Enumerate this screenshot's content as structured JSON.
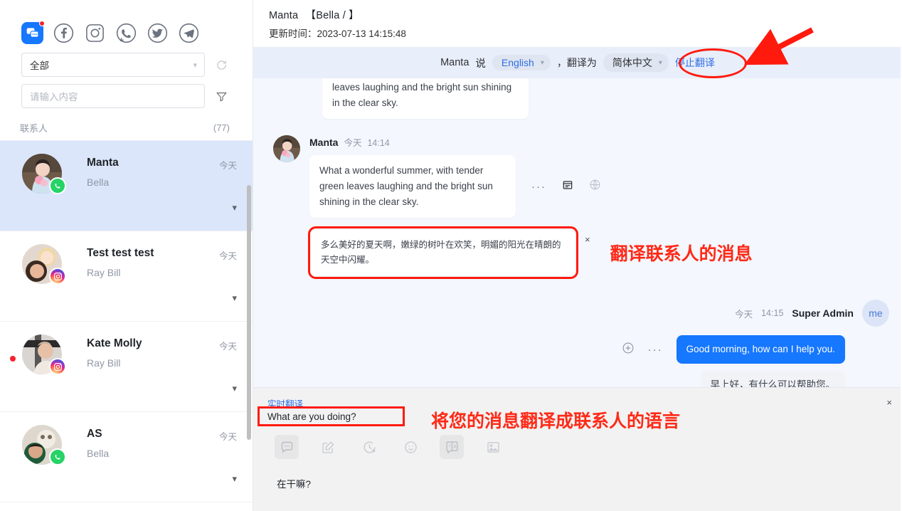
{
  "sidebar": {
    "channels": [
      {
        "name": "app-logo-icon",
        "label": "App",
        "active": true,
        "badge": true
      },
      {
        "name": "facebook-icon",
        "label": "Facebook",
        "active": false,
        "badge": false
      },
      {
        "name": "instagram-icon",
        "label": "Instagram",
        "active": false,
        "badge": false
      },
      {
        "name": "whatsapp-icon",
        "label": "WhatsApp",
        "active": false,
        "badge": false
      },
      {
        "name": "twitter-icon",
        "label": "Twitter",
        "active": false,
        "badge": false
      },
      {
        "name": "telegram-icon",
        "label": "Telegram",
        "active": false,
        "badge": false
      }
    ],
    "filter_select": {
      "value": "全部"
    },
    "refresh_icon": "refresh-icon",
    "search_input": {
      "value": "",
      "placeholder": "请输入内容"
    },
    "filter_icon": "funnel-filter-icon",
    "contacts_header": {
      "label": "联系人",
      "count": "(77)"
    },
    "contacts": [
      {
        "name": "Manta",
        "sub": "Bella",
        "time": "今天",
        "platform": "whatsapp",
        "active": true,
        "unread": false
      },
      {
        "name": "Test test test",
        "sub": "Ray Bill",
        "time": "今天",
        "platform": "instagram",
        "active": false,
        "unread": false
      },
      {
        "name": "Kate Molly",
        "sub": "Ray Bill",
        "time": "今天",
        "platform": "instagram",
        "active": false,
        "unread": true
      },
      {
        "name": "AS",
        "sub": "Bella",
        "time": "今天",
        "platform": "whatsapp",
        "active": false,
        "unread": false
      }
    ]
  },
  "chat": {
    "header": {
      "title": "Manta",
      "nickname": "【Bella / 】",
      "updated": "更新时间：2023-07-13 14:15:48"
    },
    "translate_bar": {
      "who": "Manta",
      "says": "说",
      "source_lang": "English",
      "middle": "，翻译为",
      "target_lang": "简体中文",
      "stop_label": "停止翻译"
    },
    "messages": [
      {
        "id": "partial-incoming",
        "direction": "in",
        "text": "leaves laughing and the bright sun shining in the clear sky."
      },
      {
        "id": "manta-message",
        "direction": "in",
        "sender": "Manta",
        "day": "今天",
        "time": "14:14",
        "text": "What a wonderful summer, with tender green leaves laughing and the bright sun shining in the clear sky.",
        "actions": [
          "more-icon",
          "note-icon",
          "globe-translate-icon"
        ],
        "translation": "多么美好的夏天啊，嫩绿的树叶在欢笑，明媚的阳光在晴朗的天空中闪耀。",
        "translation_close": "×"
      },
      {
        "id": "admin-message",
        "direction": "out",
        "sender": "Super Admin",
        "day": "今天",
        "time": "14:15",
        "avatar_label": "me",
        "text": "Good morning, how can I help you.",
        "translation": "早上好，有什么可以帮助您。",
        "actions": [
          "add-circle-icon",
          "more-icon"
        ]
      }
    ]
  },
  "composer": {
    "realtime_label": "实时翻译",
    "realtime_text": "What are you doing?",
    "close_label": "×",
    "tools": [
      {
        "name": "quick-reply-icon",
        "active": true
      },
      {
        "name": "compose-edit-icon",
        "active": false
      },
      {
        "name": "history-schedule-icon",
        "active": false
      },
      {
        "name": "emoji-icon",
        "active": false
      },
      {
        "name": "translate-icon",
        "active": true
      },
      {
        "name": "image-icon",
        "active": false
      }
    ],
    "input_value": "在干嘛?"
  },
  "annotations": {
    "stop_translate_note": "停止翻译",
    "translate_contact_message": "翻译联系人的消息",
    "translate_your_message": "将您的消息翻译成联系人的语言",
    "accent_red": "#ff1a0d",
    "accent_blue": "#1677ff"
  }
}
